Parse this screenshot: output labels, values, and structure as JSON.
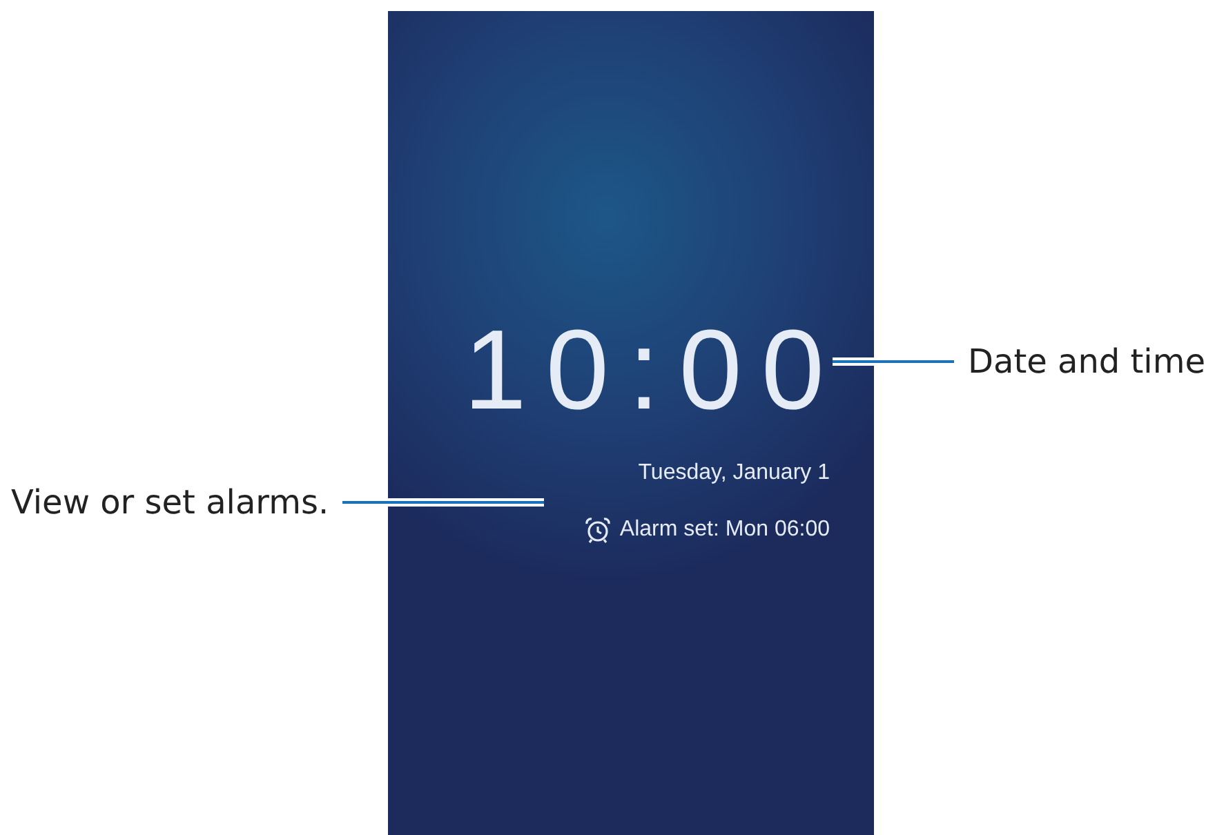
{
  "lock_screen": {
    "clock": "10:00",
    "date": "Tuesday, January 1",
    "alarm": "Alarm set: Mon 06:00"
  },
  "callouts": [
    {
      "kind": "right",
      "text": "Date and time"
    },
    {
      "kind": "left",
      "text": "View or set alarms."
    }
  ]
}
